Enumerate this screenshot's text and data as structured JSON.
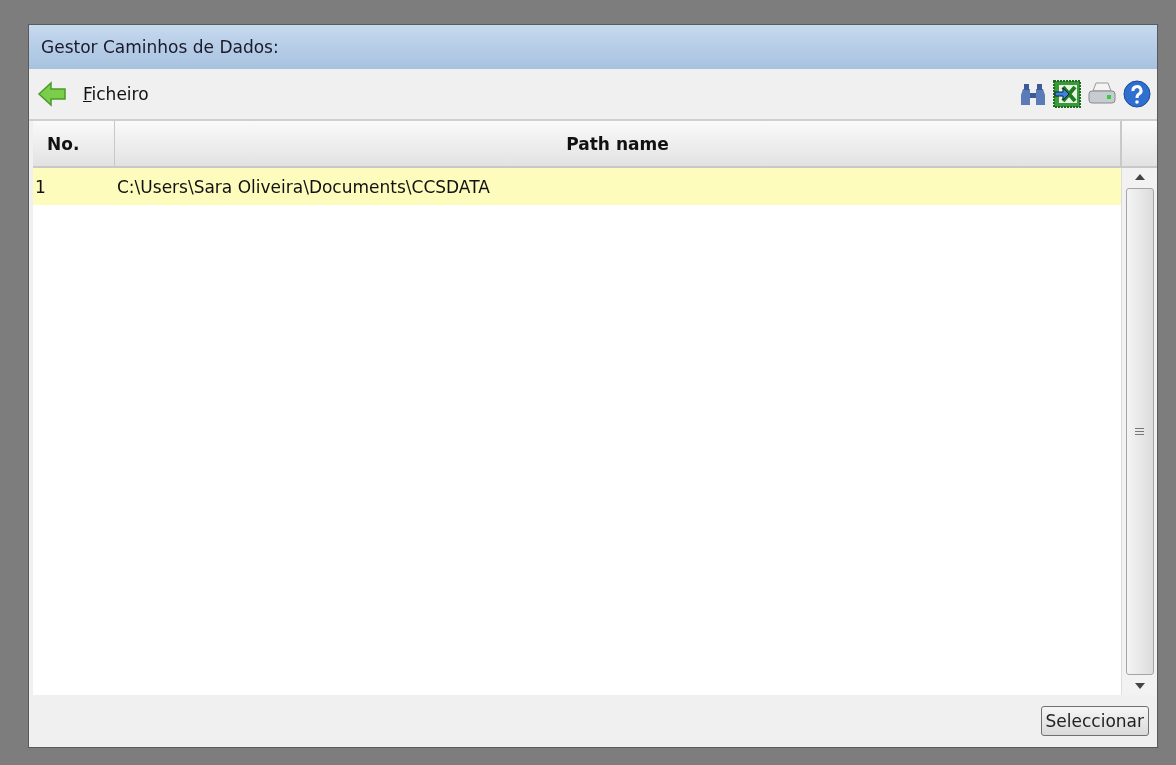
{
  "window": {
    "title": "Gestor Caminhos de Dados:"
  },
  "toolbar": {
    "menu": "Ficheiro"
  },
  "table": {
    "columns": [
      "No.",
      "Path name"
    ],
    "rows": [
      {
        "cells": [
          "1",
          "C:\\Users\\Sara Oliveira\\Documents\\CCSDATA"
        ],
        "selected": true
      }
    ]
  },
  "buttons": [
    "Seleccionar"
  ]
}
